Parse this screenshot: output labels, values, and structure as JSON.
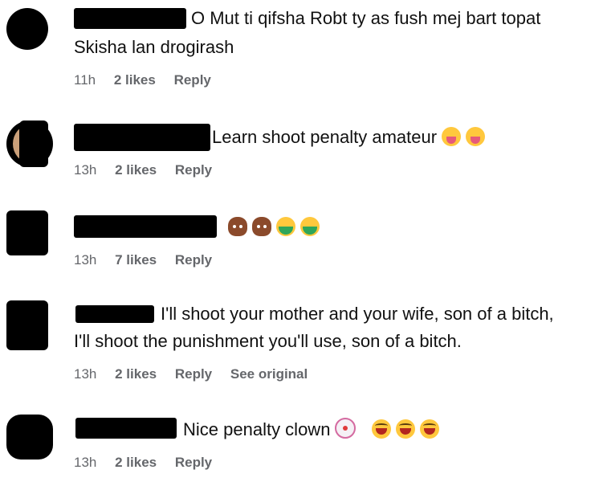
{
  "comments": [
    {
      "text_line1": "O Mut ti qifsha Robt ty as fush mej bart topat",
      "text_line2": "Skisha lan drogirash",
      "time": "11h",
      "likes": "2 likes",
      "reply": "Reply"
    },
    {
      "text_line1": "Learn shoot penalty amateur",
      "emojis": [
        "tongue-out-emoji",
        "tongue-out-emoji"
      ],
      "time": "13h",
      "likes": "2 likes",
      "reply": "Reply"
    },
    {
      "emojis": [
        "poop-emoji",
        "poop-emoji",
        "nauseated-emoji",
        "nauseated-emoji"
      ],
      "time": "13h",
      "likes": "7 likes",
      "reply": "Reply"
    },
    {
      "text_line1": "I'll shoot your mother and your wife, son of a bitch,",
      "text_line2": "I'll shoot the punishment you'll use, son of a bitch.",
      "time": "13h",
      "likes": "2 likes",
      "reply": "Reply",
      "see_original": "See original"
    },
    {
      "text_line1": "Nice penalty clown",
      "emojis": [
        "clown-emoji",
        "laughing-emoji",
        "laughing-emoji",
        "laughing-emoji"
      ],
      "time": "13h",
      "likes": "2 likes",
      "reply": "Reply"
    }
  ]
}
